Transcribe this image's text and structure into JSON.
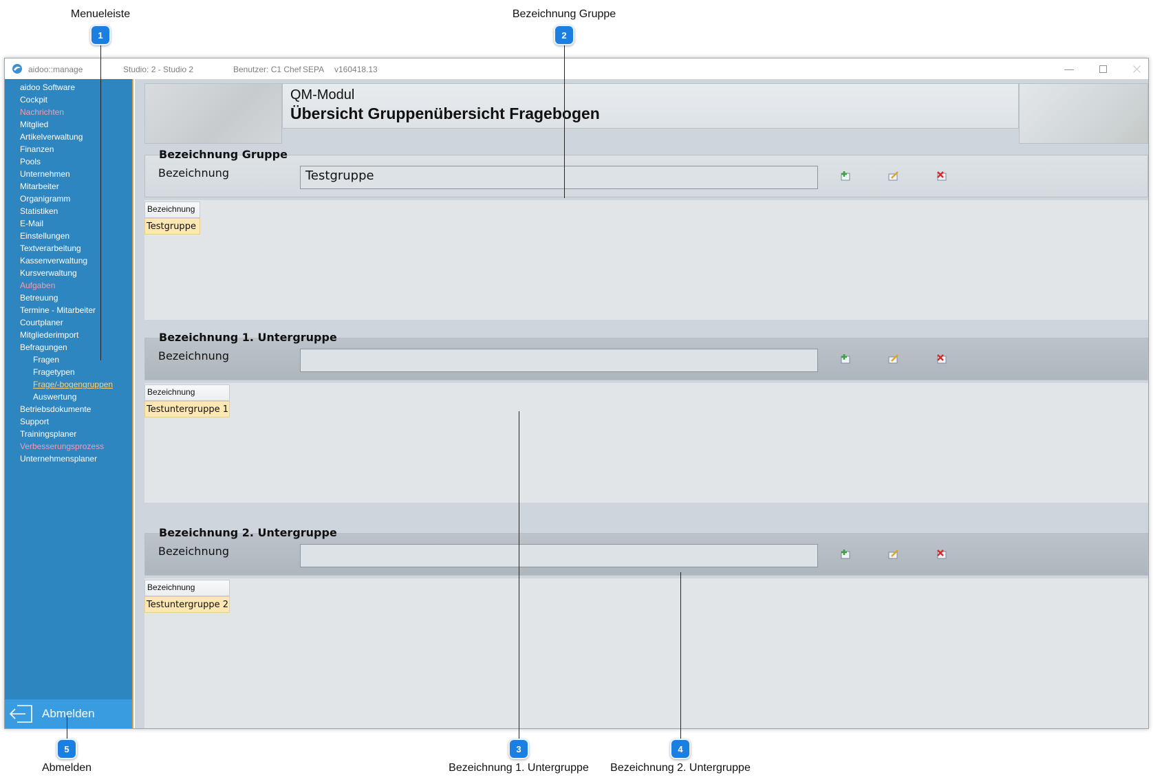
{
  "annotations": [
    {
      "number": "1",
      "label": "Menueleiste"
    },
    {
      "number": "2",
      "label": "Bezeichnung Gruppe"
    },
    {
      "number": "3",
      "label": "Bezeichnung 1. Untergruppe"
    },
    {
      "number": "4",
      "label": "Bezeichnung 2. Untergruppe"
    },
    {
      "number": "5",
      "label": "Abmelden"
    }
  ],
  "titlebar": {
    "app": "aidoo::manage",
    "studio": "Studio: 2 - Studio 2",
    "user": "Benutzer: C1 Chef",
    "sepa": "SEPA",
    "version": "v160418.13"
  },
  "sidebar": {
    "items": [
      {
        "label": "aidoo Software"
      },
      {
        "label": "Cockpit"
      },
      {
        "label": "Nachrichten"
      },
      {
        "label": "Mitglied"
      },
      {
        "label": "Artikelverwaltung"
      },
      {
        "label": "Finanzen"
      },
      {
        "label": "Pools"
      },
      {
        "label": "Unternehmen"
      },
      {
        "label": "Mitarbeiter"
      },
      {
        "label": "Organigramm"
      },
      {
        "label": "Statistiken"
      },
      {
        "label": "E-Mail"
      },
      {
        "label": "Einstellungen"
      },
      {
        "label": "Textverarbeitung"
      },
      {
        "label": "Kassenverwaltung"
      },
      {
        "label": "Kursverwaltung"
      },
      {
        "label": "Aufgaben"
      },
      {
        "label": "Betreuung"
      },
      {
        "label": "Termine - Mitarbeiter"
      },
      {
        "label": "Courtplaner"
      },
      {
        "label": "Mitgliederimport"
      },
      {
        "label": "Befragungen"
      },
      {
        "label": "Fragen"
      },
      {
        "label": "Fragetypen"
      },
      {
        "label": "Frage/-bogengruppen"
      },
      {
        "label": "Auswertung"
      },
      {
        "label": "Betriebsdokumente"
      },
      {
        "label": "Support"
      },
      {
        "label": "Trainingsplaner"
      },
      {
        "label": "Verbesserungsprozess"
      },
      {
        "label": "Unternehmensplaner"
      }
    ],
    "logout": "Abmelden"
  },
  "header": {
    "module": "QM-Modul",
    "title": "Übersicht Gruppenübersicht Fragebogen"
  },
  "groups": [
    {
      "legend": "Bezeichnung Gruppe",
      "label": "Bezeichnung",
      "value": "Testgruppe",
      "column": "Bezeichnung",
      "rows": [
        "Testgruppe"
      ]
    },
    {
      "legend": "Bezeichnung 1. Untergruppe",
      "label": "Bezeichnung",
      "value": "",
      "column": "Bezeichnung",
      "rows": [
        "Testuntergruppe 1"
      ]
    },
    {
      "legend": "Bezeichnung 2. Untergruppe",
      "label": "Bezeichnung",
      "value": "",
      "column": "Bezeichnung",
      "rows": [
        "Testuntergruppe 2"
      ]
    }
  ],
  "colors": {
    "sidebar": "#2e86c1",
    "callout": "#1a7fe0",
    "row_highlight": "#fde7b2",
    "menu_alert": "#f39cab"
  }
}
